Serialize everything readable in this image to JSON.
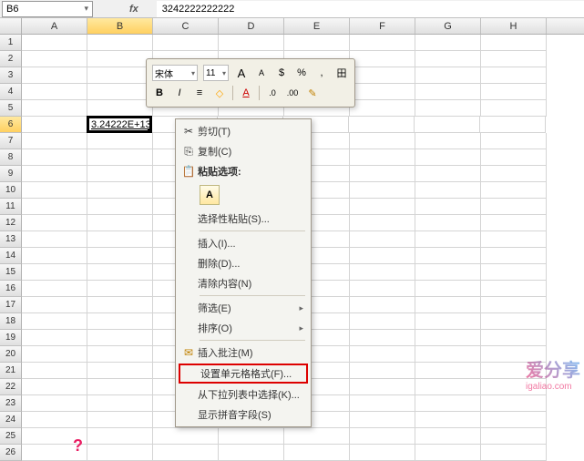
{
  "namebox": {
    "value": "B6"
  },
  "formula": {
    "value": "3242222222222"
  },
  "columns": [
    "A",
    "B",
    "C",
    "D",
    "E",
    "F",
    "G",
    "H"
  ],
  "rows_count": 26,
  "active_cell": {
    "row": 6,
    "col": "B",
    "display": "3.24222E+13"
  },
  "mini_toolbar": {
    "font_name": "宋体",
    "font_size": "11",
    "grow": "A",
    "shrink": "A",
    "bold": "B",
    "italic": "I",
    "percent": "%",
    "comma": ",",
    "currency": "$",
    "fill": "◇",
    "fontcolor": "A",
    "align": "≡",
    "border": "田",
    "inc_dec": ".0",
    "dec_dec": ".00",
    "format_painter": "✎"
  },
  "context_menu": {
    "cut": "剪切(T)",
    "copy": "复制(C)",
    "paste_header": "粘贴选项:",
    "paste_opt": "A",
    "paste_special": "选择性粘贴(S)...",
    "insert": "插入(I)...",
    "delete": "删除(D)...",
    "clear": "清除内容(N)",
    "filter": "筛选(E)",
    "sort": "排序(O)",
    "comment": "插入批注(M)",
    "format_cells": "设置单元格格式(F)...",
    "pick_list": "从下拉列表中选择(K)...",
    "phonetic": "显示拼音字段(S)"
  },
  "icons": {
    "scissors": "✂",
    "copy": "⎘",
    "clipboard": "📋",
    "comment_ico": "✉",
    "arrow": "▸"
  },
  "watermark": {
    "main": "爱分享",
    "sub": "igaliao.com"
  }
}
